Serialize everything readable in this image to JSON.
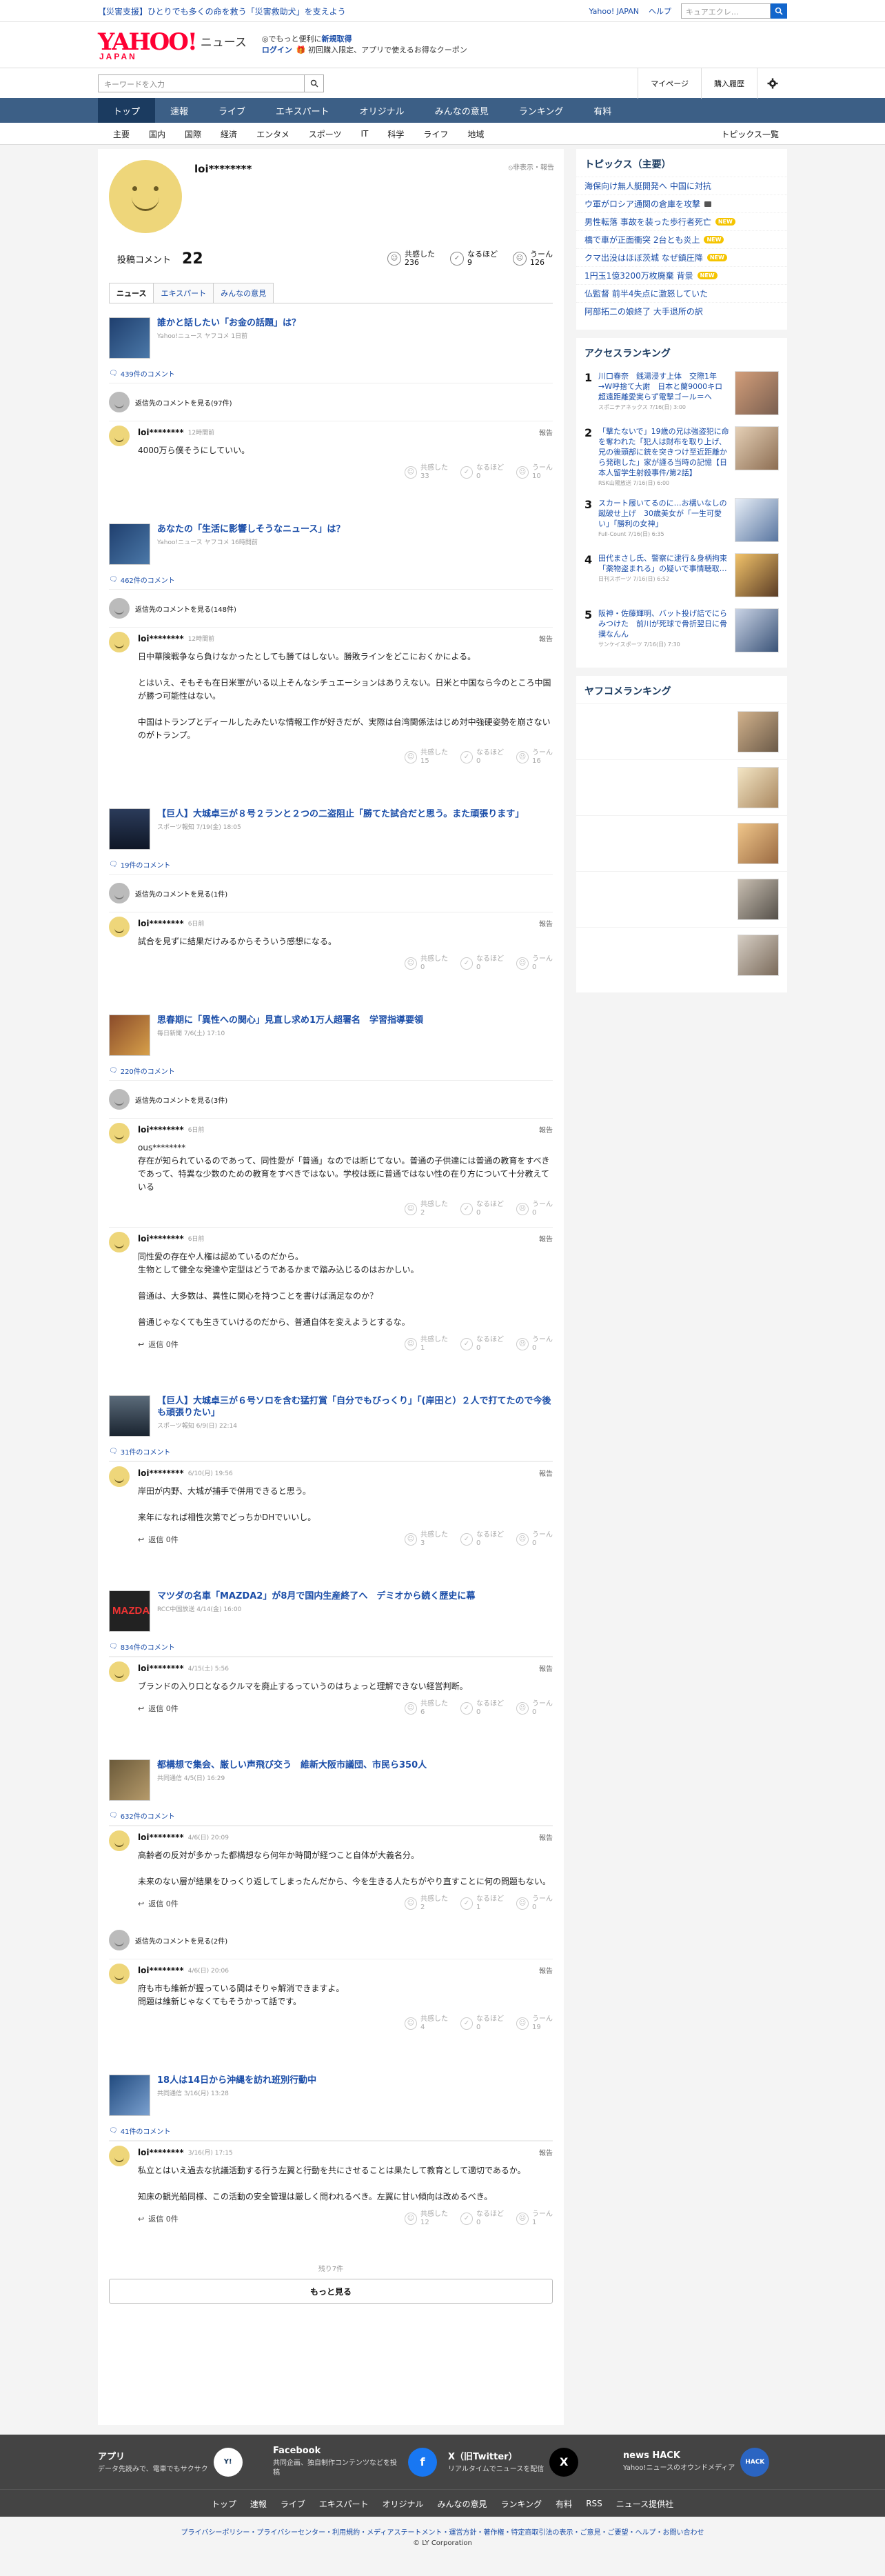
{
  "alert": {
    "text": "【災害支援】ひとりでも多くの命を救う「災害救助犬」を支えよう"
  },
  "top_links": {
    "yahoo_japan": "Yahoo! JAPAN",
    "help": "ヘルプ",
    "search_placeholder": "ウェブ検索",
    "search_value": "キュアエクレ…"
  },
  "header": {
    "logo": "YAHOO!",
    "logo_sub": "JAPAN",
    "news": "ニュース",
    "promo_line1_prefix": "◎でもっと便利に",
    "promo_line1_link": "新規取得",
    "promo_line2_link": "ログイン",
    "promo_line2_text": "🎁 初回購入限定、アプリで使えるお得なクーポン"
  },
  "search": {
    "placeholder": "キーワードを入力",
    "mypage": "マイページ",
    "history": "購入履歴"
  },
  "main_nav": [
    {
      "label": "トップ",
      "active": true
    },
    {
      "label": "速報"
    },
    {
      "label": "ライブ"
    },
    {
      "label": "エキスパート"
    },
    {
      "label": "オリジナル"
    },
    {
      "label": "みんなの意見"
    },
    {
      "label": "ランキング"
    },
    {
      "label": "有料"
    }
  ],
  "sub_nav": [
    "主要",
    "国内",
    "国際",
    "経済",
    "エンタメ",
    "スポーツ",
    "IT",
    "科学",
    "ライフ",
    "地域"
  ],
  "sub_nav_right": "トピックス一覧",
  "profile": {
    "name": "loi********",
    "hide": "非表示・報告",
    "post_label": "投稿コメント",
    "post_count": "22",
    "reactions": [
      {
        "label": "共感した",
        "count": "236"
      },
      {
        "label": "なるほど",
        "count": "9"
      },
      {
        "label": "うーん",
        "count": "126"
      }
    ],
    "tabs": [
      "ニュース",
      "エキスパート",
      "みんなの意見"
    ]
  },
  "blocks": [
    {
      "thumb": "t-navy",
      "title": "誰かと話したい「お金の話題」は？",
      "source": "Yahoo!ニュース ヤフコメ 1日前",
      "comment_count": "439件のコメント",
      "replies_link": "返信先のコメントを見る(97件)",
      "comments": [
        {
          "user": "loi********",
          "ago": "12時間前",
          "text": "4000万ら僕そうにしていい。",
          "reply": "",
          "r1": "33",
          "r2": "0",
          "r3": "10"
        }
      ]
    },
    {
      "thumb": "t-navy",
      "title": "あなたの「生活に影響しそうなニュース」は？",
      "source": "Yahoo!ニュース ヤフコメ 16時間前",
      "comment_count": "462件のコメント",
      "replies_link": "返信先のコメントを見る(148件)",
      "comments": [
        {
          "user": "loi********",
          "ago": "12時間前",
          "text": "日中華険戦争なら負けなかったとしても勝てはしない。勝敗ラインをどこにおくかによる。\n\nとはいえ、そもそも在日米軍がいる以上そんなシチュエーションはありえない。日米と中国なら今のところ中国が勝つ可能性はない。\n\n中国はトランプとディールしたみたいな情報工作が好きだが、実際は台湾関係法はじめ対中強硬姿勢を崩さないのがトランプ。",
          "reply": "",
          "r1": "15",
          "r2": "0",
          "r3": "16"
        }
      ]
    },
    {
      "thumb": "t-night",
      "title": "【巨人】大城卓三が８号２ランと２つの二盗阻止「勝てた試合だと思う。また頑張ります」",
      "source": "スポーツ報知 7/19(金) 18:05",
      "comment_count": "19件のコメント",
      "replies_link": "返信先のコメントを見る(1件)",
      "comments": [
        {
          "user": "loi********",
          "ago": "6日前",
          "text": "試合を見ずに結果だけみるからそういう感想になる。",
          "reply": "",
          "r1": "0",
          "r2": "0",
          "r3": "0"
        }
      ]
    },
    {
      "thumb": "t-paper",
      "title": "思春期に「異性への関心」見直し求め1万人超署名　学習指導要領",
      "source": "毎日新聞 7/6(土) 17:10",
      "comment_count": "220件のコメント",
      "replies_link": "返信先のコメントを見る(3件)",
      "comments": [
        {
          "user": "loi********",
          "ago": "6日前",
          "text": "ous********\n存在が知られているのであって、同性愛が「普通」なのでは断じてない。普通の子供達には普通の教育をすべきであって、特異な少数のための教育をすべきではない。学校は既に普通ではない性の在り方について十分教えている",
          "reply": "",
          "r1": "2",
          "r2": "0",
          "r3": "0"
        },
        {
          "user": "loi********",
          "ago": "6日前",
          "text": "同性愛の存在や人権は認めているのだから。\n生物として健全な発達や定型はどうであるかまで踏み込じるのはおかしい。\n\n普通は、大多数は、異性に関心を持つことを書けば満足なのか？\n\n普通じゃなくても生きていけるのだから、普通自体を変えようとするな。",
          "reply": "返信 0件",
          "r1": "1",
          "r2": "0",
          "r3": "0"
        }
      ]
    },
    {
      "thumb": "t-crowd",
      "title": "【巨人】大城卓三が６号ソロを含む猛打賞「自分でもびっくり」「(岸田と）２人で打てたので今後も頑張りたい」",
      "source": "スポーツ報知 6/9(日) 22:14",
      "comment_count": "31件のコメント",
      "replies_link": "",
      "comments": [
        {
          "user": "loi********",
          "ago": "6/10(月) 19:56",
          "text": "岸田が内野、大城が捕手で併用できると思う。\n\n来年になれば相性次第でどっちかDHでいいし。",
          "reply": "返信 0件",
          "r1": "3",
          "r2": "0",
          "r3": "0"
        }
      ]
    },
    {
      "thumb": "t-mazda",
      "title": "マツダの名車「MAZDA2」が8月で国内生産終了へ　デミオから続く歴史に幕",
      "source": "RCC中国放送 4/14(金) 16:00",
      "comment_count": "834件のコメント",
      "replies_link": "",
      "comments": [
        {
          "user": "loi********",
          "ago": "4/15(土) 5:56",
          "text": "ブランドの入り口となるクルマを廃止するっていうのはちょっと理解できない経営判断。",
          "reply": "返信 0件",
          "r1": "6",
          "r2": "0",
          "r3": "0"
        }
      ]
    },
    {
      "thumb": "t-hall",
      "title": "都構想で集会、厳しい声飛び交う　維新大阪市議団、市民ら350人",
      "source": "共同通信 4/5(日) 16:29",
      "comment_count": "632件のコメント",
      "replies_link": "",
      "comments": [
        {
          "user": "loi********",
          "ago": "4/6(日) 20:09",
          "text": "高齢者の反対が多かった都構想なら何年か時間が経つこと自体が大義名分。\n\n未来のない層が結果をひっくり返してしまったんだから、今を生きる人たちがやり直すことに何の問題もない。",
          "reply": "返信 0件",
          "r1": "2",
          "r2": "1",
          "r3": "0"
        }
      ],
      "replies_link_after": "返信先のコメントを見る(2件)",
      "comments_after": [
        {
          "user": "loi********",
          "ago": "4/6(日) 20:06",
          "text": "府も市も維新が握っている間はそりゃ解消できますよ。\n問題は維新じゃなくてもそうかって話です。",
          "reply": "",
          "r1": "4",
          "r2": "0",
          "r3": "19"
        }
      ]
    },
    {
      "thumb": "t-okinawa",
      "title": "18人は14日から沖縄を訪れ班別行動中",
      "source": "共同通信 3/16(月) 13:28",
      "comment_count": "41件のコメント",
      "replies_link": "",
      "comments": [
        {
          "user": "loi********",
          "ago": "3/16(月) 17:15",
          "text": "私立とはいえ過去な抗議活動する行う左翼と行動を共にさせることは果たして教育として適切であるか。\n\n知床の観光船同様、この活動の安全管理は厳しく問われるべき。左翼に甘い傾向は改めるべき。",
          "reply": "返信 0件",
          "r1": "12",
          "r2": "0",
          "r3": "1"
        }
      ]
    }
  ],
  "more": {
    "remain": "残り7件",
    "button": "もっと見る"
  },
  "topics": {
    "title": "トピックス（主要）",
    "items": [
      {
        "text": "海保向け無人艇開発へ 中国に対抗",
        "badge": ""
      },
      {
        "text": "ウ軍がロシア通関の倉庫を攻撃",
        "badge": "cam"
      },
      {
        "text": "男性転落 事故を装った歩行者死亡",
        "badge": "NEW"
      },
      {
        "text": "橋で車が正面衝突 2台とも炎上",
        "badge": "NEW"
      },
      {
        "text": "クマ出没はほぼ茨城 なぜ鎮圧降",
        "badge": "NEW"
      },
      {
        "text": "1円玉1億3200万枚廃棄 背景",
        "badge": "NEW"
      },
      {
        "text": "仏監督 前半4失点に激怒していた",
        "badge": ""
      },
      {
        "text": "阿部拓二の娘終了 大手退所の訳",
        "badge": ""
      }
    ]
  },
  "access_ranking": {
    "title": "アクセスランキング",
    "items": [
      {
        "num": "1",
        "title": "川口春奈　銭湯浸す上体　交際1年→W呼捨て大謝　日本と蘭9000キロ超遠距離愛実らず電撃ゴール＝ヘ",
        "source": "スポニチアネックス 7/16(日) 3:00",
        "thumb": "th1"
      },
      {
        "num": "2",
        "title": "「撃たないで」19歳の兄は強盗犯に命を奪われた「犯人は財布を取り上げ、兄の後頭部に銃を突きつけ至近距離から発砲した」家が謹る当時の記憶【日本人留学生射殺事件/第2話】",
        "source": "RSK山陽放送 7/16(日) 6:00",
        "thumb": "th2"
      },
      {
        "num": "3",
        "title": "スカート履いてるのに…お構いなしの蹴破せ上げ　30歳美女が「一生可愛い」「勝利の女神」",
        "source": "Full-Count 7/16(日) 6:35",
        "thumb": "th3"
      },
      {
        "num": "4",
        "title": "田代まさし氏、警察に逮行＆身柄拘束「薬物盗まれる」の疑いで事情聴取…",
        "source": "日刊スポーツ 7/16(日) 6:52",
        "thumb": "th4"
      },
      {
        "num": "5",
        "title": "阪神・佐藤輝明、バット投げ詰でにらみつけた　前川が死球で骨折翌日に骨撲なんん",
        "source": "サンケイスポーツ 7/16(日) 7:30",
        "thumb": "th5"
      }
    ]
  },
  "yahoo_ranking": {
    "title": "ヤフコメランキング",
    "thumbs": [
      "yt1",
      "yt2",
      "yt3",
      "yt4",
      "yt5"
    ]
  },
  "footer": {
    "apps": [
      {
        "title": "アプリ",
        "desc": "データ先読みで、電車でもサクサク",
        "icon": "ia",
        "icon_text": "Y!"
      },
      {
        "title": "Facebook",
        "desc": "共同企画、独自制作コンテンツなどを投稿",
        "icon": "ifb",
        "icon_text": "f"
      },
      {
        "title": "X（旧Twitter）",
        "desc": "リアルタイムでニュースを配信",
        "icon": "ix",
        "icon_text": "X"
      },
      {
        "title": "news HACK",
        "desc": "Yahoo!ニュースのオウンドメディア",
        "icon": "ih",
        "icon_text": "HACK"
      }
    ],
    "nav": [
      "トップ",
      "速報",
      "ライブ",
      "エキスパート",
      "オリジナル",
      "みんなの意見",
      "ランキング",
      "有料",
      "RSS",
      "ニュース提供社"
    ],
    "links": "プライバシーポリシー・プライバシーセンター・利用規約・メディアステートメント・運営方針・著作権・特定商取引法の表示・ご意見・ご要望・ヘルプ・お問い合わせ",
    "copyright": "© LY Corporation"
  }
}
